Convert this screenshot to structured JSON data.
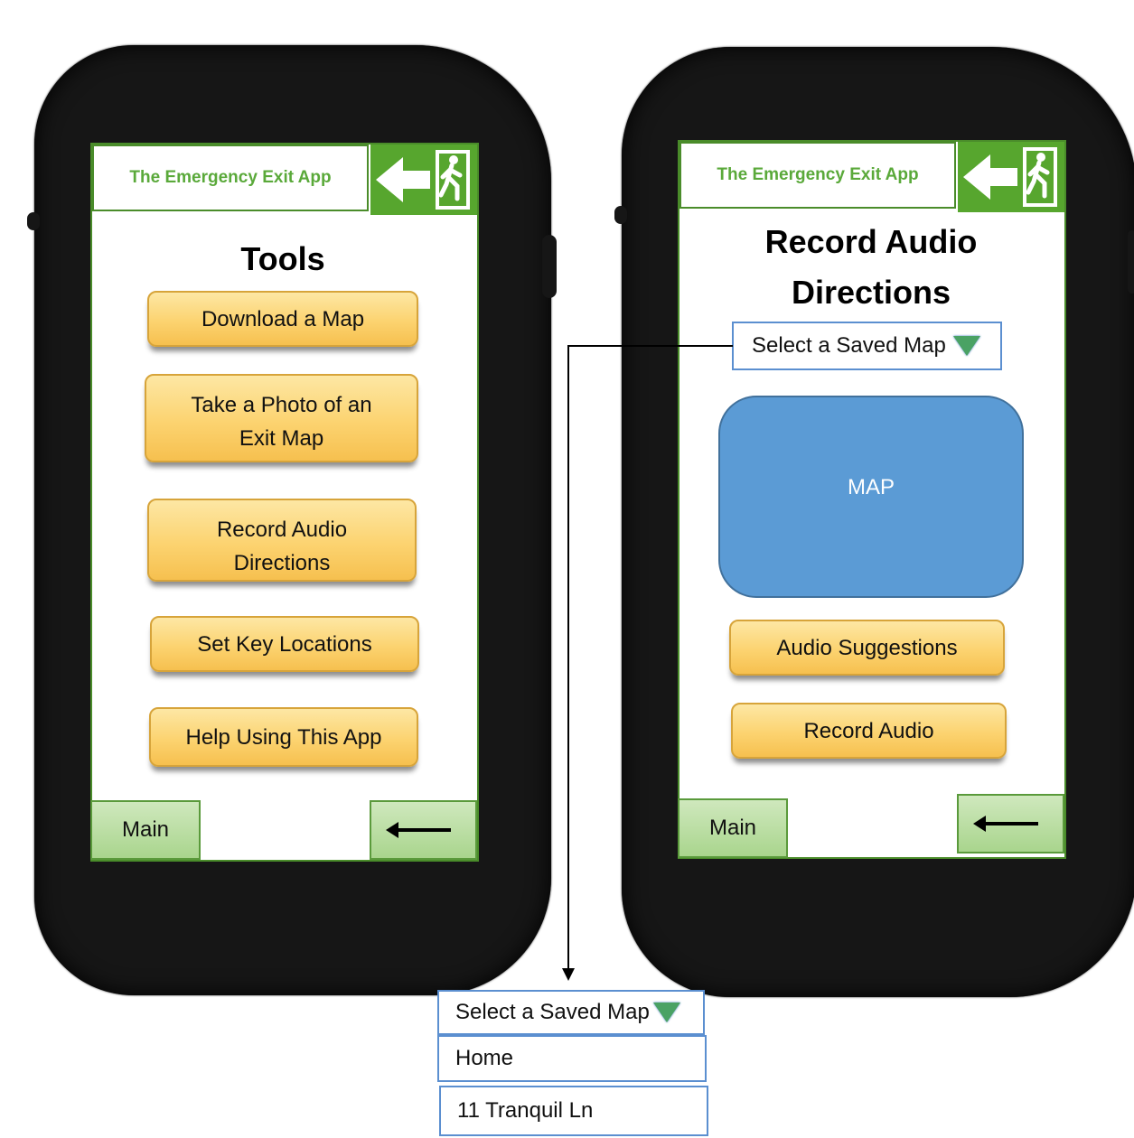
{
  "left_screen": {
    "header_title": "The Emergency Exit App",
    "page_title": "Tools",
    "buttons": [
      {
        "label": "Download a Map"
      },
      {
        "label_lines": [
          "Take a Photo of an",
          "Exit Map"
        ]
      },
      {
        "label_lines": [
          "Record Audio",
          "Directions"
        ]
      },
      {
        "label": "Set Key Locations"
      },
      {
        "label": "Help Using This App"
      }
    ],
    "nav_main_label": "Main"
  },
  "right_screen": {
    "header_title": "The Emergency Exit App",
    "page_title_lines": [
      "Record Audio",
      "Directions"
    ],
    "select_label": "Select a Saved Map",
    "map_label": "MAP",
    "buttons": [
      {
        "label": "Audio Suggestions"
      },
      {
        "label": "Record Audio"
      }
    ],
    "nav_main_label": "Main"
  },
  "dropdown_expanded": {
    "select_label": "Select a Saved Map",
    "options": [
      "Home",
      "11 Tranquil Ln"
    ]
  },
  "colors": {
    "header_text": "#5aa93a",
    "exit_sign": "#57a62e",
    "button_fill": "#fcd370",
    "nav_fill": "#a9d58d",
    "map_fill": "#5b9bd5",
    "select_border": "#5b8fd0"
  },
  "icons": [
    "exit-sign-icon",
    "back-arrow-icon",
    "dropdown-triangle-icon"
  ]
}
